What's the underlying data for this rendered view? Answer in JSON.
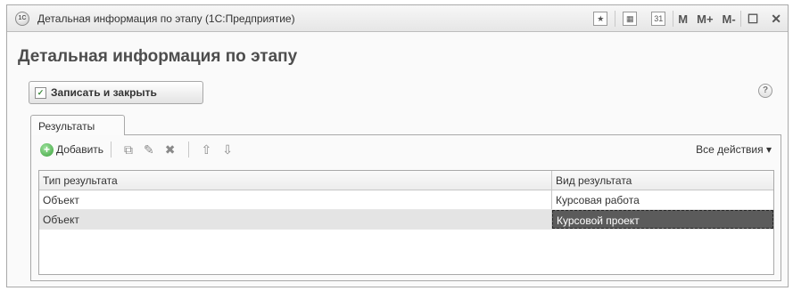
{
  "window": {
    "title": "Детальная информация по этапу  (1С:Предприятие)",
    "app_icon_text": "1С",
    "toolbar": {
      "memory_buttons": [
        "M",
        "M+",
        "M-"
      ],
      "calendar_label": "31"
    }
  },
  "form": {
    "title": "Детальная информация по этапу",
    "save_close_label": "Записать и закрыть",
    "help_label": "?"
  },
  "tabs": [
    {
      "label": "Результаты",
      "active": true
    }
  ],
  "command_bar": {
    "add_label": "Добавить",
    "all_actions_label": "Все действия ▾"
  },
  "table": {
    "columns": [
      "Тип результата",
      "Вид результата"
    ],
    "rows": [
      {
        "type": "Объект",
        "kind": "Курсовая работа",
        "selected": false
      },
      {
        "type": "Объект",
        "kind": "Курсовой проект",
        "selected": true
      }
    ]
  }
}
